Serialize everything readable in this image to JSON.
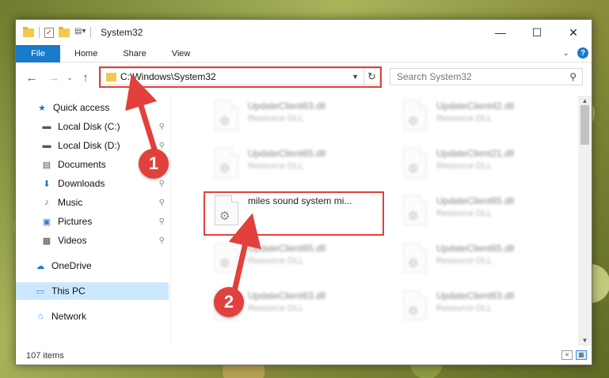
{
  "window": {
    "title": "System32",
    "controls": {
      "minimize": "—",
      "maximize": "☐",
      "close": "✕"
    }
  },
  "ribbon": {
    "tabs": [
      "File",
      "Home",
      "Share",
      "View"
    ],
    "help": "?",
    "expand": "⌄"
  },
  "navigation": {
    "back": "←",
    "forward": "→",
    "recent": "⌄",
    "up": "↑",
    "address": "C:\\Windows\\System32",
    "refresh": "↻",
    "search_placeholder": "Search System32"
  },
  "sidebar": {
    "items": [
      {
        "label": "Quick access",
        "icon": "star-icon",
        "glyph": "★",
        "color": "#1979ca",
        "pinned": false
      },
      {
        "label": "Local Disk (C:)",
        "icon": "drive-icon",
        "glyph": "▬",
        "color": "#555555",
        "pinned": true
      },
      {
        "label": "Local Disk (D:)",
        "icon": "drive-icon",
        "glyph": "▬",
        "color": "#555555",
        "pinned": true
      },
      {
        "label": "Documents",
        "icon": "document-icon",
        "glyph": "▤",
        "color": "#555555",
        "pinned": true
      },
      {
        "label": "Downloads",
        "icon": "download-icon",
        "glyph": "⬇",
        "color": "#1979ca",
        "pinned": true
      },
      {
        "label": "Music",
        "icon": "music-icon",
        "glyph": "♪",
        "color": "#1979ca",
        "pinned": true
      },
      {
        "label": "Pictures",
        "icon": "pictures-icon",
        "glyph": "▣",
        "color": "#3a7bd5",
        "pinned": true
      },
      {
        "label": "Videos",
        "icon": "video-icon",
        "glyph": "▦",
        "color": "#444444",
        "pinned": true
      },
      {
        "label": "OneDrive",
        "icon": "cloud-icon",
        "glyph": "☁",
        "color": "#1979ca",
        "pinned": false
      },
      {
        "label": "This PC",
        "icon": "computer-icon",
        "glyph": "▭",
        "color": "#3a8ee6",
        "pinned": false,
        "selected": true
      },
      {
        "label": "Network",
        "icon": "network-icon",
        "glyph": "⌂",
        "color": "#3a8ee6",
        "pinned": false
      }
    ],
    "pin_glyph": "📌"
  },
  "files": [
    {
      "name": "UpdateClient63.dll",
      "type": "Resource DLL",
      "blurred": true
    },
    {
      "name": "UpdateClient42.dll",
      "type": "Resource DLL",
      "blurred": true
    },
    {
      "name": "UpdateClient65.dll",
      "type": "Resource DLL",
      "blurred": true
    },
    {
      "name": "UpdateClient21.dll",
      "type": "Resource DLL",
      "blurred": true
    },
    {
      "name": "miles sound system mi...",
      "type": "",
      "blurred": false,
      "highlighted": true
    },
    {
      "name": "UpdateClient65.dll",
      "type": "Resource DLL",
      "blurred": true
    },
    {
      "name": "UpdateClient65.dll",
      "type": "Resource DLL",
      "blurred": true
    },
    {
      "name": "UpdateClient65.dll",
      "type": "Resource DLL",
      "blurred": true
    },
    {
      "name": "UpdateClient63.dll",
      "type": "Resource DLL",
      "blurred": true
    },
    {
      "name": "UpdateClient63.dll",
      "type": "Resource DLL",
      "blurred": true
    }
  ],
  "status": {
    "count": "107 items"
  },
  "annotations": {
    "step1": "1",
    "step2": "2",
    "color": "#e2403c"
  }
}
